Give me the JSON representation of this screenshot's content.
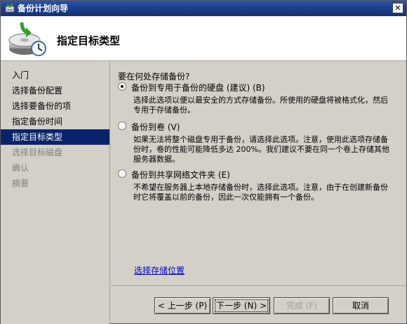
{
  "window": {
    "title": "备份计划向导"
  },
  "header": {
    "title": "指定目标类型"
  },
  "nav": {
    "items": [
      {
        "label": "入门",
        "state": "normal"
      },
      {
        "label": "选择备份配置",
        "state": "normal"
      },
      {
        "label": "选择要备份的项",
        "state": "normal"
      },
      {
        "label": "指定备份时间",
        "state": "normal"
      },
      {
        "label": "指定目标类型",
        "state": "active"
      },
      {
        "label": "选择目标磁盘",
        "state": "disabled"
      },
      {
        "label": "确认",
        "state": "disabled"
      },
      {
        "label": "摘要",
        "state": "disabled"
      }
    ]
  },
  "content": {
    "question": "要在何处存储备份?",
    "options": [
      {
        "label": "备份到专用于备份的硬盘 (建议) (B)",
        "desc": "选择此选项以便以最安全的方式存储备份。所使用的硬盘将被格式化，然后专用于存储备份。",
        "checked": true
      },
      {
        "label": "备份到卷 (V)",
        "desc": "如果无法将整个磁盘专用于备份，请选择此选项。注意，使用此选项存储备份时，卷的性能可能降低多达 200%。我们建议不要在同一个卷上存储其他服务器数据。",
        "checked": false
      },
      {
        "label": "备份到共享网络文件夹 (E)",
        "desc": "不希望在服务器上本地存储备份时，选择此选项。注意，由于在创建新备份时它将覆盖以前的备份，因此一次仅能拥有一个备份。",
        "checked": false
      }
    ],
    "link": "选择存储位置"
  },
  "buttons": {
    "back": "< 上一步 (P)",
    "next": "下一步 (N) >",
    "finish": "完成 (F)",
    "cancel": "取消"
  },
  "icons": {
    "close": "close-icon",
    "window": "backup-wizard-icon",
    "header": "backup-disk-icon"
  },
  "colors": {
    "titlebar": "#1c3f8f",
    "active_nav": "#0a246a",
    "link": "#0000cc"
  }
}
